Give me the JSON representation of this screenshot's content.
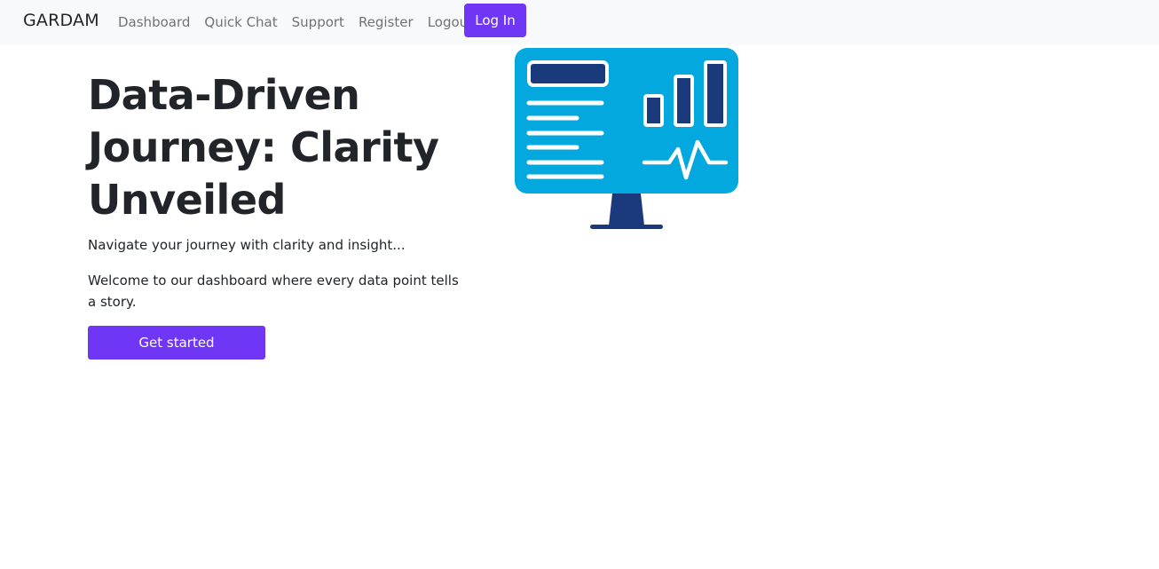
{
  "navbar": {
    "brand": "GARDAM",
    "links": [
      "Dashboard",
      "Quick Chat",
      "Support",
      "Register",
      "Logout"
    ],
    "login_label": "Log In"
  },
  "hero": {
    "title": "Data-Driven Journey: Clarity Unveiled",
    "subtitle": "Navigate your journey with clarity and insight...",
    "description": "Welcome to our dashboard where every data point tells a story.",
    "cta_label": "Get started"
  },
  "illustration": {
    "icon": "dashboard-monitor-icon",
    "colors": {
      "screen": "#02a8de",
      "stand": "#1a3a7c",
      "accent": "#ffffff"
    }
  },
  "colors": {
    "primary": "#6f36f5",
    "navbar_bg": "#f8f9fa",
    "text": "#212529"
  }
}
